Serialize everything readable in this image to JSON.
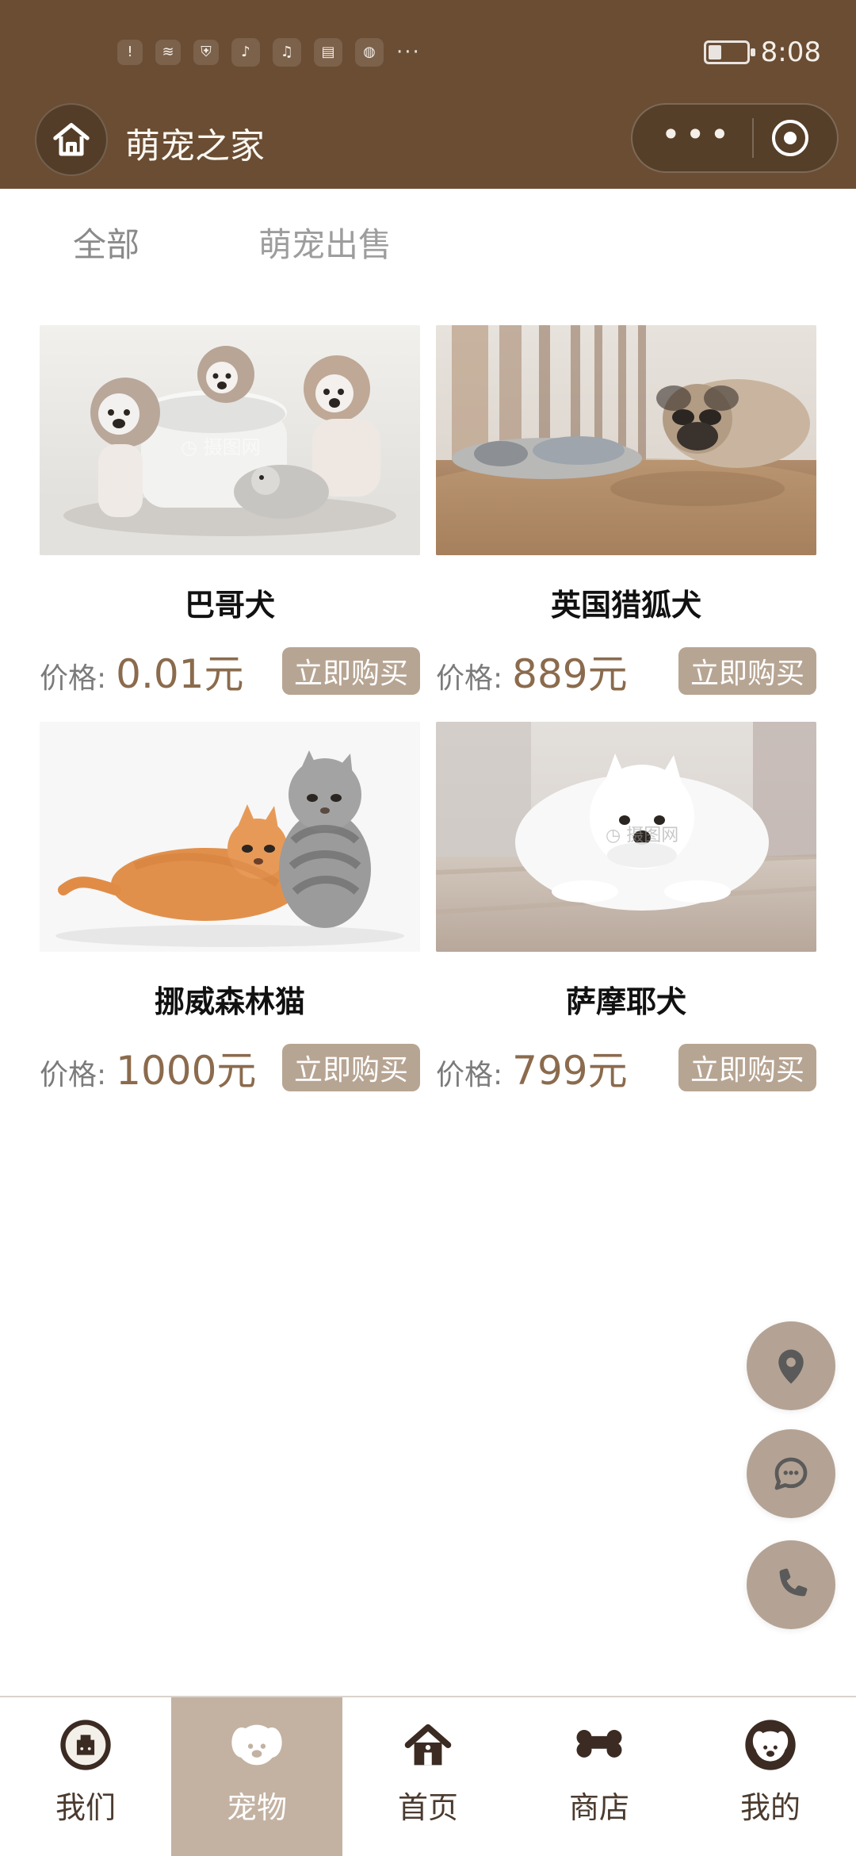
{
  "status_bar": {
    "time": "8:08"
  },
  "header": {
    "title": "萌宠之家"
  },
  "tabs": [
    {
      "label": "全部"
    },
    {
      "label": "萌宠出售"
    }
  ],
  "products": [
    {
      "name": "巴哥犬",
      "price_label": "价格:",
      "price": "0.01元",
      "buy_label": "立即购买"
    },
    {
      "name": "英国猎狐犬",
      "price_label": "价格:",
      "price": "889元",
      "buy_label": "立即购买"
    },
    {
      "name": "挪威森林猫",
      "price_label": "价格:",
      "price": "1000元",
      "buy_label": "立即购买"
    },
    {
      "name": "萨摩耶犬",
      "price_label": "价格:",
      "price": "799元",
      "buy_label": "立即购买"
    }
  ],
  "fabs": [
    {
      "icon": "location-pin-icon"
    },
    {
      "icon": "chat-bubble-icon"
    },
    {
      "icon": "phone-icon"
    }
  ],
  "bottom_nav": [
    {
      "label": "我们",
      "icon": "logo-badge-icon"
    },
    {
      "label": "宠物",
      "icon": "dog-face-icon"
    },
    {
      "label": "首页",
      "icon": "house-icon"
    },
    {
      "label": "商店",
      "icon": "bone-icon"
    },
    {
      "label": "我的",
      "icon": "profile-dog-icon"
    }
  ],
  "colors": {
    "header_bg": "#6a4d33",
    "accent": "#b7a593",
    "price_text": "#8b6b4d",
    "tabbar_active": "#c3b2a2",
    "fab_bg": "#b4a394"
  }
}
